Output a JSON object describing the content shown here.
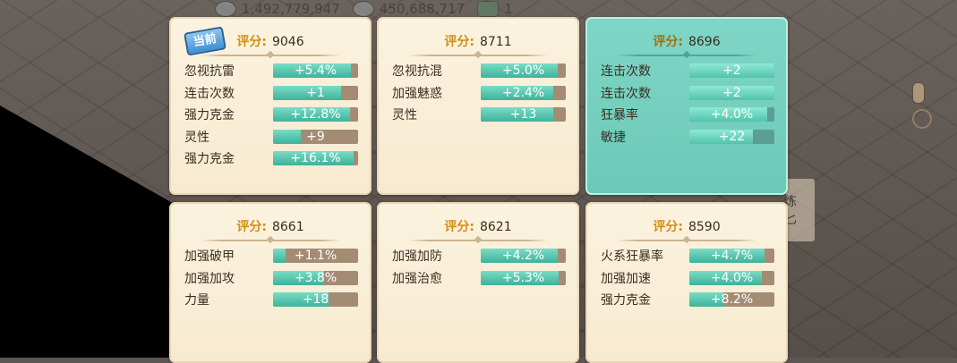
{
  "resources": [
    {
      "icon": "silver-coin-icon",
      "value": "1,492,779,947"
    },
    {
      "icon": "gold-ingot-icon",
      "value": "450,688,717"
    },
    {
      "icon": "jade-icon",
      "value": "1"
    }
  ],
  "score_label": "评分:",
  "current_badge": "当前",
  "side_text": [
    "炼",
    "匕"
  ],
  "colors": {
    "selected_card": "#6cc9b7",
    "card": "#f7ead0",
    "bar_fill": "#3fb29a",
    "bar_track": "#a48c74",
    "score_label": "#d58c12"
  },
  "cards": [
    {
      "score": "9046",
      "current": true,
      "selected": false,
      "attrs": [
        {
          "name": "忽视抗雷",
          "value": "+5.4%",
          "fill": 0.92
        },
        {
          "name": "连击次数",
          "value": "+1",
          "fill": 0.8
        },
        {
          "name": "强力克金",
          "value": "+12.8%",
          "fill": 0.9
        },
        {
          "name": "灵性",
          "value": "+9",
          "fill": 0.33
        },
        {
          "name": "强力克金",
          "value": "+16.1%",
          "fill": 0.95
        }
      ]
    },
    {
      "score": "8711",
      "current": false,
      "selected": false,
      "attrs": [
        {
          "name": "忽视抗混",
          "value": "+5.0%",
          "fill": 0.9
        },
        {
          "name": "加强魅惑",
          "value": "+2.4%",
          "fill": 0.85
        },
        {
          "name": "灵性",
          "value": "+13",
          "fill": 0.85
        }
      ]
    },
    {
      "score": "8696",
      "current": false,
      "selected": true,
      "attrs": [
        {
          "name": "连击次数",
          "value": "+2",
          "fill": 1.0
        },
        {
          "name": "连击次数",
          "value": "+2",
          "fill": 1.0
        },
        {
          "name": "狂暴率",
          "value": "+4.0%",
          "fill": 0.92
        },
        {
          "name": "敏捷",
          "value": "+22",
          "fill": 0.75
        }
      ]
    },
    {
      "score": "8661",
      "current": false,
      "selected": false,
      "attrs": [
        {
          "name": "加强破甲",
          "value": "+1.1%",
          "fill": 0.15
        },
        {
          "name": "加强加攻",
          "value": "+3.8%",
          "fill": 0.6
        },
        {
          "name": "力量",
          "value": "+18",
          "fill": 0.65
        }
      ]
    },
    {
      "score": "8621",
      "current": false,
      "selected": false,
      "attrs": [
        {
          "name": "加强加防",
          "value": "+4.2%",
          "fill": 0.9
        },
        {
          "name": "加强治愈",
          "value": "+5.3%",
          "fill": 0.92
        }
      ]
    },
    {
      "score": "8590",
      "current": false,
      "selected": false,
      "attrs": [
        {
          "name": "火系狂暴率",
          "value": "+4.7%",
          "fill": 0.88
        },
        {
          "name": "加强加速",
          "value": "+4.0%",
          "fill": 0.85
        },
        {
          "name": "强力克金",
          "value": "+8.2%",
          "fill": 0.4
        }
      ]
    }
  ]
}
